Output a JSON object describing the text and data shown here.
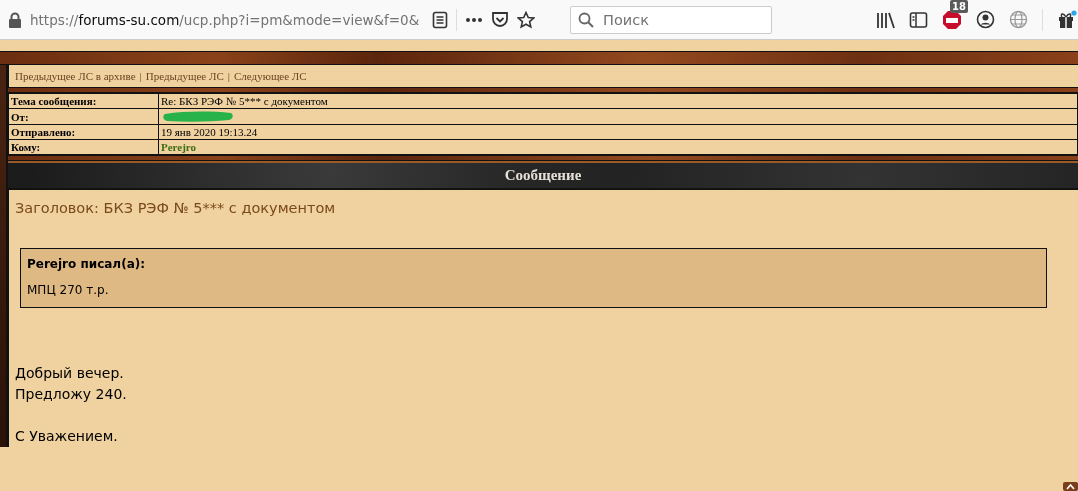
{
  "browser": {
    "url": "https://**forums-su.com**/ucp.php?i=pm&mode=view&f=0&",
    "search_placeholder": "Поиск",
    "adblock_badge": "18"
  },
  "nav_links": [
    "Предыдущее ЛС в архиве",
    "Предыдущее ЛС",
    "Следующее ЛС"
  ],
  "nav_separator": "|",
  "details": [
    {
      "label": "Тема сообщения:",
      "value": "Re: БКЗ РЭФ № 5*** с документом",
      "kind": "text"
    },
    {
      "label": "От:",
      "kind": "redacted"
    },
    {
      "label": "Отправлено:",
      "value": "19 янв 2020 19:13.24",
      "kind": "text"
    },
    {
      "label": "Кому:",
      "value": "Perejro",
      "kind": "user"
    }
  ],
  "section_title": "Сообщение",
  "message": {
    "subject": "Заголовок: БКЗ РЭФ № 5*** с документом",
    "quote": {
      "author": "Perejro писал(а):",
      "text": "МПЦ 270 т.р."
    },
    "paragraphs": [
      "Добрый вечер.\nПредложу 240.",
      "С Уважением."
    ]
  }
}
